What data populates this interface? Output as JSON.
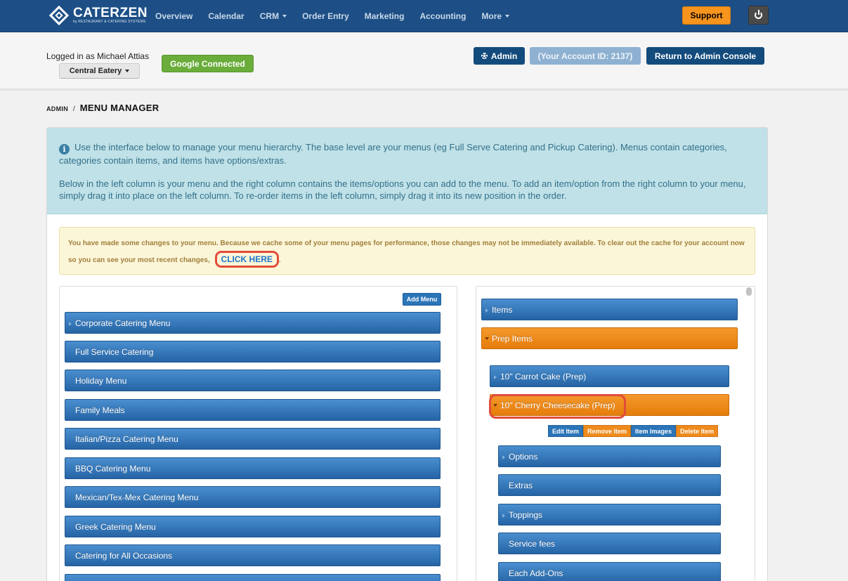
{
  "app": {
    "logo_name": "CATERZEN",
    "logo_sub": "by RESTAURANT & CATERING SYSTEMS"
  },
  "nav": {
    "items": [
      {
        "label": "Overview",
        "dropdown": false
      },
      {
        "label": "Calendar",
        "dropdown": false
      },
      {
        "label": "CRM",
        "dropdown": true
      },
      {
        "label": "Order Entry",
        "dropdown": false
      },
      {
        "label": "Marketing",
        "dropdown": false
      },
      {
        "label": "Accounting",
        "dropdown": false
      },
      {
        "label": "More",
        "dropdown": true
      }
    ],
    "support_label": "Support"
  },
  "subheader": {
    "logged_in": "Logged in as Michael Attias",
    "location": "Central Eatery",
    "google_label": "Google Connected",
    "admin_label": "Admin",
    "account_id_label": "(Your Account ID: 2137)",
    "return_label": "Return to Admin Console"
  },
  "breadcrumb": {
    "parent": "ADMIN",
    "separator": "/",
    "current": "MENU MANAGER"
  },
  "info": {
    "p1": "Use the interface below to manage your menu hierarchy. The base level are your menus (eg Full Serve Catering and Pickup Catering). Menus contain categories, categories contain items, and items have options/extras.",
    "p2": "Below in the left column is your menu and the right column contains the items/options you can add to the menu. To add an item/option from the right column to your menu, simply drag it into place on the left column. To re-order items in the left column, simply drag it into its new position in the order."
  },
  "cache_notice": {
    "text": "You have made some changes to your menu. Because we cache some of your menu pages for performance, those changes may not be immediately available. To clear out the cache for your account now so you can see your most recent changes,",
    "link_label": "CLICK HERE",
    "trailing": "."
  },
  "left_column": {
    "add_menu_label": "Add Menu",
    "menus": [
      "Corporate Catering Menu",
      "Full Service Catering",
      "Holiday Menu",
      "Family Meals",
      "Italian/Pizza Catering Menu",
      "BBQ Catering Menu",
      "Mexican/Tex-Mex Catering Menu",
      "Greek Catering Menu",
      "Catering for All Occasions",
      ""
    ]
  },
  "right_column": {
    "items_label": "Items",
    "prep_items_label": "Prep Items",
    "prep_children": [
      {
        "label": "10\" Carrot Cake (Prep)",
        "expanded": false
      },
      {
        "label": "10\" Cherry Cheesecake (Prep)",
        "expanded": true
      }
    ],
    "item_actions": [
      {
        "label": "Edit Item",
        "color": "#2b75b8"
      },
      {
        "label": "Remove Item",
        "color": "#ef8a1c"
      },
      {
        "label": "Item Images",
        "color": "#2b75b8"
      },
      {
        "label": "Delete Item",
        "color": "#ef8a1c"
      }
    ],
    "sub_groups": [
      "Options",
      "Extras",
      "Toppings",
      "Service fees",
      "Each Add-Ons"
    ]
  },
  "colors": {
    "nav_bg": "#1d4f86",
    "accent_orange": "#f7941d",
    "bar_blue": "#2b75b8",
    "success_green": "#6aad3b",
    "highlight_red": "#e24b3a"
  }
}
